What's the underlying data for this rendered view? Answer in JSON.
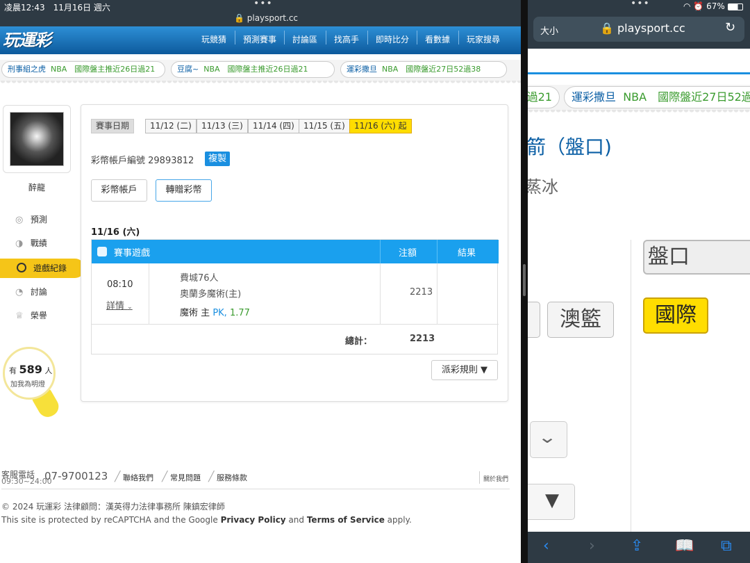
{
  "left": {
    "status": {
      "time": "凌晨12:43　11月16日 週六",
      "dots": "•••",
      "url": "🔒 playsport.cc"
    },
    "logo": "玩運彩",
    "nav": [
      "玩競猜",
      "預測賽事",
      "討論區",
      "找高手",
      "即時比分",
      "看數據",
      "玩家搜尋"
    ],
    "ticker": [
      {
        "name": "刑事組之虎",
        "content": "NBA　國際盤主推近26日過21"
      },
      {
        "name": "豆腐~",
        "content": "NBA　國際盤主推近26日過21"
      },
      {
        "name": "運彩撒旦",
        "content": "NBA　國際盤近27日52過38"
      }
    ],
    "user": {
      "name": "醉龍"
    },
    "sidebar": [
      {
        "label": "預測",
        "icon": "target-icon"
      },
      {
        "label": "戰績",
        "icon": "record-icon"
      },
      {
        "label": "遊戲紀錄",
        "icon": "game-record-icon",
        "active": true
      },
      {
        "label": "討論",
        "icon": "discussion-icon"
      },
      {
        "label": "榮譽",
        "icon": "honor-icon"
      }
    ],
    "bulb": {
      "prefix": "有",
      "count": "589",
      "suffix": "人",
      "text": "加我為明燈"
    },
    "dates": {
      "label": "賽事日期",
      "items": [
        "11/12 (二)",
        "11/13 (三)",
        "11/14 (四)",
        "11/15 (五)",
        "11/16 (六) 起"
      ],
      "active_index": 4
    },
    "account": {
      "label": "彩幣帳戶編號 29893812",
      "copy": "複製"
    },
    "buttons": {
      "coin_account": "彩幣帳戶",
      "transfer": "轉贈彩幣"
    },
    "game_date": "11/16 (六)",
    "table": {
      "headers": [
        "賽事遊戲",
        "注額",
        "結果"
      ],
      "row": {
        "time": "08:10",
        "details": "詳情",
        "team1": "費城76人",
        "team2": "奧蘭多魔術(主)",
        "pick_team": "魔術",
        "pick_side": "主",
        "pick_type": "PK,",
        "odds": "1.77",
        "amount": "2213",
        "result": ""
      },
      "total_label": "總計：",
      "total": "2213"
    },
    "rule_button": "派彩規則 ▼",
    "footer": {
      "phone_label": "客服電話",
      "phone_hours": "09:30~24:00",
      "phone": "07-9700123",
      "links": [
        "聯絡我們",
        "常見問題",
        "服務條款"
      ],
      "about": "關於我們",
      "copyright": "© 2024 玩運彩 法律顧問：漢英得力法律事務所 陳鎮宏律師",
      "recaptcha_pre": "This site is protected by reCAPTCHA and the Google ",
      "privacy": "Privacy Policy",
      "and": " and ",
      "terms": "Terms of Service",
      "apply": " apply."
    }
  },
  "right": {
    "dots": "•••",
    "status": "67%",
    "size": "大小",
    "url": "🔒 playsport.cc",
    "ticker_prefix": "過21",
    "ticker": {
      "name": "運彩撒旦",
      "content": "NBA　國際盤近27日52過"
    },
    "title": "箭（盤口)",
    "subtitle": "蒸冰",
    "pan_label": "盤口",
    "au_button": "澳籃",
    "intl_button": "國際"
  },
  "colors": {
    "accent": "#1aa0ee",
    "active": "#ffdd00",
    "brand": "#0d5a9c"
  }
}
